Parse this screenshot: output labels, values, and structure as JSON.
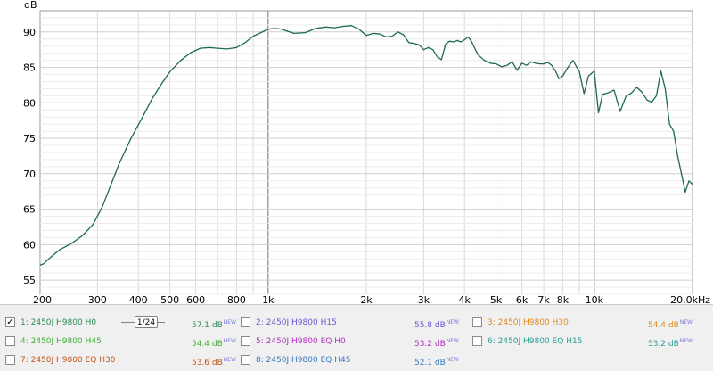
{
  "chart_data": {
    "type": "line",
    "ylabel": "dB",
    "xscale": "log",
    "xlim": [
      200,
      20000
    ],
    "ylim": [
      53,
      93
    ],
    "y_ticks": [
      55,
      60,
      65,
      70,
      75,
      80,
      85,
      90
    ],
    "x_ticks": [
      {
        "value": 200,
        "label": "200"
      },
      {
        "value": 300,
        "label": "300"
      },
      {
        "value": 400,
        "label": "400"
      },
      {
        "value": 500,
        "label": "500"
      },
      {
        "value": 600,
        "label": "600"
      },
      {
        "value": 800,
        "label": "800"
      },
      {
        "value": 1000,
        "label": "1k"
      },
      {
        "value": 2000,
        "label": "2k"
      },
      {
        "value": 3000,
        "label": "3k"
      },
      {
        "value": 4000,
        "label": "4k"
      },
      {
        "value": 5000,
        "label": "5k"
      },
      {
        "value": 6000,
        "label": "6k"
      },
      {
        "value": 7000,
        "label": "7k"
      },
      {
        "value": 8000,
        "label": "8k"
      },
      {
        "value": 10000,
        "label": "10k"
      },
      {
        "value": 20000,
        "label": "20.0kHz"
      }
    ],
    "grid": true,
    "series": [
      {
        "name": "1: 2450J H9800 H0",
        "color": "#1d6b45",
        "x": [
          200,
          205,
          215,
          230,
          250,
          270,
          290,
          310,
          330,
          350,
          380,
          410,
          440,
          470,
          500,
          540,
          580,
          620,
          660,
          700,
          750,
          800,
          850,
          900,
          950,
          1000,
          1050,
          1100,
          1150,
          1200,
          1300,
          1400,
          1500,
          1600,
          1700,
          1800,
          1900,
          2000,
          2100,
          2200,
          2300,
          2400,
          2500,
          2600,
          2700,
          2800,
          2900,
          3000,
          3100,
          3200,
          3300,
          3400,
          3500,
          3600,
          3700,
          3800,
          3900,
          4000,
          4100,
          4200,
          4300,
          4400,
          4600,
          4800,
          5000,
          5200,
          5400,
          5600,
          5800,
          6000,
          6200,
          6400,
          6600,
          6800,
          7000,
          7200,
          7400,
          7600,
          7800,
          8000,
          8300,
          8600,
          9000,
          9300,
          9600,
          10000,
          10300,
          10600,
          11000,
          11500,
          12000,
          12500,
          13000,
          13500,
          14000,
          14500,
          15000,
          15500,
          16000,
          16500,
          17000,
          17500,
          18000,
          18500,
          19000,
          19500,
          20000
        ],
        "y": [
          57.1,
          57.3,
          58.2,
          59.3,
          60.2,
          61.3,
          62.8,
          65.3,
          68.5,
          71.5,
          75.0,
          77.8,
          80.5,
          82.6,
          84.4,
          86.0,
          87.1,
          87.7,
          87.8,
          87.7,
          87.6,
          87.8,
          88.5,
          89.4,
          89.9,
          90.4,
          90.5,
          90.4,
          90.1,
          89.8,
          89.9,
          90.5,
          90.7,
          90.6,
          90.8,
          90.9,
          90.4,
          89.5,
          89.8,
          89.7,
          89.3,
          89.4,
          90.0,
          89.6,
          88.5,
          88.4,
          88.2,
          87.5,
          87.8,
          87.5,
          86.5,
          86.1,
          88.3,
          88.7,
          88.6,
          88.8,
          88.6,
          88.9,
          89.3,
          88.7,
          87.7,
          86.8,
          86.0,
          85.6,
          85.5,
          85.1,
          85.3,
          85.8,
          84.6,
          85.6,
          85.3,
          85.8,
          85.6,
          85.5,
          85.5,
          85.7,
          85.3,
          84.5,
          83.4,
          83.8,
          85.0,
          86.0,
          84.4,
          81.3,
          83.8,
          84.5,
          78.6,
          81.2,
          81.4,
          81.8,
          78.8,
          80.9,
          81.4,
          82.2,
          81.5,
          80.4,
          80.1,
          81.0,
          84.5,
          82.0,
          77.0,
          76.0,
          72.5,
          70.0,
          67.4,
          69.0,
          68.5
        ]
      }
    ]
  },
  "legend": {
    "items": [
      {
        "label": "1: 2450J H9800 H0",
        "value": "57.1 dB",
        "badge": "NEW",
        "color": "#2e8b57",
        "checked": true
      },
      {
        "label": "2: 2450J H9800 H15",
        "value": "55.8 dB",
        "badge": "NEW",
        "color": "#6a5acd",
        "checked": false
      },
      {
        "label": "3: 2450J H9800 H30",
        "value": "54.4 dB",
        "badge": "NEW",
        "color": "#e08a1e",
        "checked": false
      },
      {
        "label": "4: 2450J H9800 H45",
        "value": "54.4 dB",
        "badge": "NEW",
        "color": "#3cb034",
        "checked": false
      },
      {
        "label": "5: 2450J H9800 EQ H0",
        "value": "53.2 dB",
        "badge": "NEW",
        "color": "#b030c0",
        "checked": false
      },
      {
        "label": "6: 2450J H9800 EQ H15",
        "value": "53.2 dB",
        "badge": "NEW",
        "color": "#2aa198",
        "checked": false
      },
      {
        "label": "7: 2450J H9800 EQ H30",
        "value": "53.6 dB",
        "badge": "NEW",
        "color": "#c0541a",
        "checked": false
      },
      {
        "label": "8: 2450J H9800 EQ H45",
        "value": "52.1 dB",
        "badge": "NEW",
        "color": "#3a78c0",
        "checked": false
      }
    ],
    "smoothing": "1/24",
    "checkmark": "✓"
  }
}
